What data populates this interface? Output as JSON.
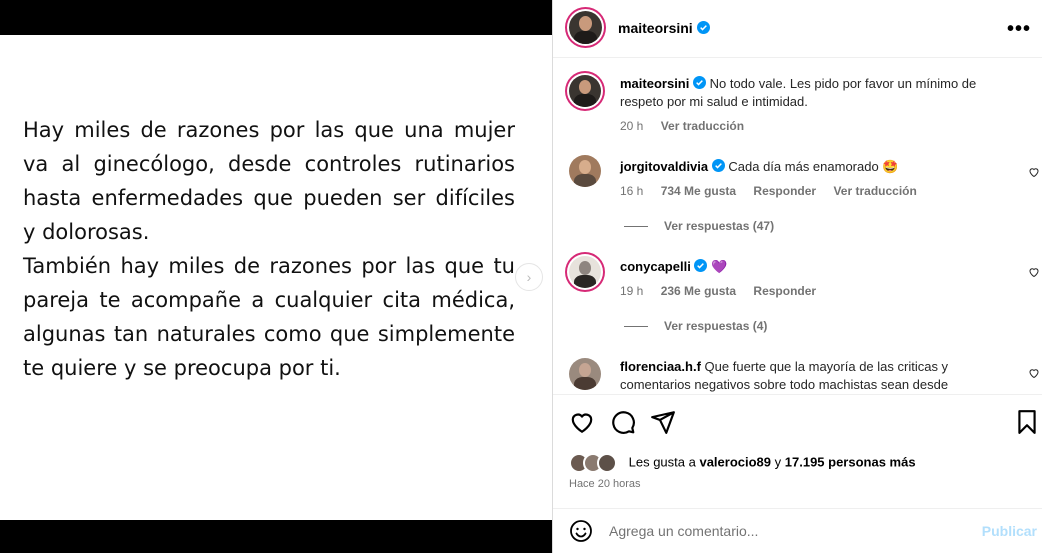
{
  "post": {
    "paragraph1": "Hay miles de razones por las que una mujer va al ginecólogo, desde controles rutinarios hasta enfermedades que pueden ser difíciles y dolorosas.",
    "paragraph2": "También hay miles de razones por las que tu pareja te acompañe a cualquier cita médica, algunas tan naturales como que simplemente te quiere y se preocupa por ti."
  },
  "header": {
    "username": "maiteorsini",
    "more_label": "•••"
  },
  "caption": {
    "username": "maiteorsini",
    "text": "No todo vale. Les pido por favor un mínimo de respeto por mi salud e intimidad.",
    "time": "20 h",
    "translate": "Ver traducción"
  },
  "comments": [
    {
      "username": "jorgitovaldivia",
      "text": "Cada día más enamorado 🤩",
      "time": "16 h",
      "likes": "734 Me gusta",
      "reply": "Responder",
      "translate": "Ver traducción",
      "replies": "Ver respuestas (47)"
    },
    {
      "username": "conycapelli",
      "text": "💜",
      "time": "19 h",
      "likes": "236 Me gusta",
      "reply": "Responder",
      "replies": "Ver respuestas (4)"
    },
    {
      "username": "florenciaa.h.f",
      "text": "Que fuerte que la mayoría de las criticas y comentarios negativos sobre todo machistas sean desde"
    }
  ],
  "likes": {
    "prefix": "Les gusta a",
    "user": "valerocio89",
    "connector": "y",
    "count": "17.195 personas más"
  },
  "time_ago": "Hace 20 horas",
  "composer": {
    "placeholder": "Agrega un comentario...",
    "post_label": "Publicar"
  },
  "colors": {
    "verified": "#0095f6",
    "muted": "#737373",
    "post_disabled": "#b2dffc"
  }
}
